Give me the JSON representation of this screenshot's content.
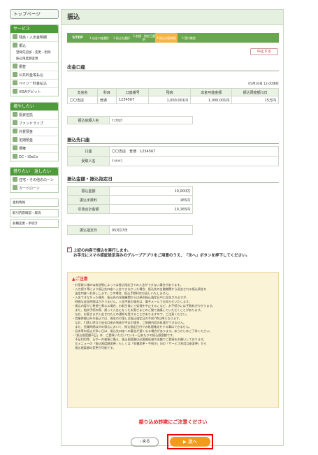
{
  "sidebar": {
    "top_button": "トップページ",
    "service_title": "サービス",
    "service_items": [
      "残高・入出金明細",
      "振込"
    ],
    "sub_items": [
      "登録先追加・変更・削除",
      "振込限度額変更"
    ],
    "service_items2": [
      "振替",
      "公共料金等払込",
      "ペイジー料金払込",
      "VISAデビット"
    ],
    "save_title": "増やしたい",
    "save_items": [
      "投資信託",
      "ファンドラップ",
      "外貨預金",
      "定期預金",
      "債権",
      "DC・iDeCo"
    ],
    "borrow_title": "借りたい　返したい",
    "borrow_items": [
      "住宅・その他のローン",
      "カードローン"
    ],
    "links": [
      "金利情報",
      "取引内容確認・取消",
      "各種変更・手続き"
    ]
  },
  "page_title": "振込",
  "steps": {
    "label": "STEP",
    "items": [
      "1.出金口座選択",
      "2.振込先選択",
      "3.金額・指定日選択",
      "4.振込内容確認",
      "5.受付確認"
    ]
  },
  "stop_button": "中止する",
  "withdraw": {
    "title": "出金口座",
    "date": "05月16日 12:00現在",
    "headers": [
      "支店名",
      "科目",
      "口座番号",
      "残高",
      "出金可能金額",
      "振込限度額/1日"
    ],
    "row": [
      "〇〇支店",
      "普通",
      "1234567",
      "1,000,001円",
      "1,000,001円",
      "15万円"
    ],
    "requester_label": "振込依頼人名",
    "requester_value": "ﾘｿﾅﾀﾛｳ"
  },
  "dest": {
    "title": "振込先口座",
    "account_label": "口座",
    "branch": "〇〇支店",
    "type": "普通",
    "number": "1234567",
    "name_label": "受取人名",
    "name_value": "ﾘｿﾅﾊﾅｺ"
  },
  "amount": {
    "title": "振込金額・振込指定日",
    "rows": [
      [
        "振込金額",
        "10,000円"
      ],
      [
        "振込手数料",
        "165円"
      ],
      [
        "引落合計金額",
        "10,165円"
      ]
    ],
    "date_label": "振込指定日",
    "date_value": "05月17日"
  },
  "confirm": {
    "line1": "上記の内容で振込を実行します。",
    "line2": "お手元にスマホ認証設定済みのグループアプリをご用意のうえ、「次へ」ボタンを押下してください。"
  },
  "notice": {
    "title": "ご注意",
    "lines": [
      "・お受取人様の口座状態によっては振込指定日での入金ができない場合があります。",
      "・入力誤り等により振込先口座へ入金できなかった場合、振込先の金融機関から返金される振込資金を",
      "　出金口座へお戻しします。この場合、振込手数料はお返しいたしません。",
      "・入金できなかった場合、振込先の金融機関からは原則振込指定日中に返金されますが、",
      "　時間な返金時間はかかりません。入金不能の場合は、電子メールでお知らせいたします。",
      "・振込内容がご希望と異なる場合、お取引後にて処理を中止するこなど、お手続きには手数料がかかります。",
      "　また、組戻手続の際、誤って入金になったお客さまとのご間で協議していただくことがあります。",
      "　なお、お客さまが入金されたとの通知を受けることがありますので、ご注意ください。",
      "・営業時間以外の振込では、資金の引落しは振込指定日の手前7時以降となります。",
      "　なお、引落し時点で出金口座の残高が不足の場合、ご依頼内容の処理ができません。",
      "　また、営業時間以外の振込において、振込指定日付での処理確定をする事はできません。",
      "・月末等の振込が多い日は、振込先口座への着金が遅くなる場合があります。あらかじめご了承ください。",
      "・「振込限度額/1日」は、ご登録いただいている一日あたりの振込限度額です。",
      "　不足利用等、万が一の被害に備え、振込限度額は必要最低限の金額でご登録をお願いしております。",
      "　左メニューの「振込限度額変更」もしくは「各種変更・手続き」内の「サービス利用口座変更」から",
      "　振込限度額の変更が可能です。"
    ]
  },
  "warning": "振り込め詐欺にご注意ください",
  "back_button": "戻る",
  "next_button": "次へ"
}
